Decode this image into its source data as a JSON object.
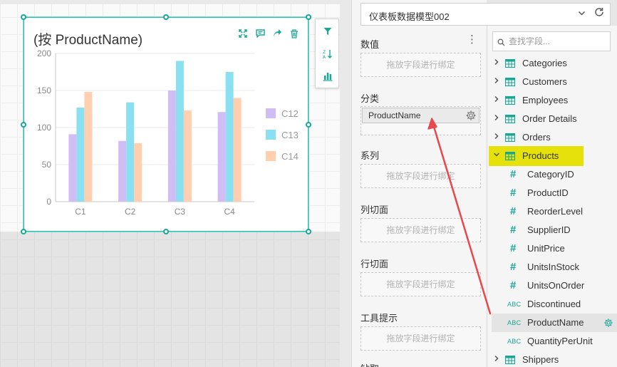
{
  "chart": {
    "title": "(按 ProductName)",
    "toolbar": {
      "expand_icon": "expand-icon",
      "comment_icon": "comment-icon",
      "share_icon": "share-icon",
      "delete_icon": "trash-icon"
    }
  },
  "side_toolbar": [
    "filter-icon",
    "sort-icon",
    "bar-chart-icon"
  ],
  "chart_data": {
    "type": "bar",
    "categories": [
      "C1",
      "C2",
      "C3",
      "C4"
    ],
    "series": [
      {
        "name": "C12",
        "values": [
          91,
          82,
          150,
          121
        ],
        "color": "#d0bdf3"
      },
      {
        "name": "C13",
        "values": [
          127,
          134,
          190,
          175
        ],
        "color": "#8ae0f0"
      },
      {
        "name": "C14",
        "values": [
          148,
          79,
          123,
          140
        ],
        "color": "#ffcfaf"
      }
    ],
    "yticks": [
      0,
      50,
      100,
      150,
      200
    ],
    "ylim": [
      0,
      200
    ],
    "grid": true,
    "legend": "right"
  },
  "binding": {
    "model_name": "仪表板数据模型002",
    "sections": {
      "values": "数值",
      "category": "分类",
      "series": "系列",
      "col_slicer": "列切面",
      "row_slicer": "行切面",
      "tooltip": "工具提示",
      "partial_next": "钻取"
    },
    "drop_placeholder": "拖放字段进行绑定",
    "category_field": "ProductName"
  },
  "fields": {
    "search_placeholder": "查找字段...",
    "tables": [
      {
        "name": "Categories",
        "expanded": false
      },
      {
        "name": "Customers",
        "expanded": false
      },
      {
        "name": "Employees",
        "expanded": false
      },
      {
        "name": "Order Details",
        "expanded": false
      },
      {
        "name": "Orders",
        "expanded": false
      },
      {
        "name": "Products",
        "expanded": true
      },
      {
        "name": "Shippers",
        "expanded": false
      }
    ],
    "products_fields": [
      {
        "name": "CategoryID",
        "type": "#"
      },
      {
        "name": "ProductID",
        "type": "#"
      },
      {
        "name": "ReorderLevel",
        "type": "#"
      },
      {
        "name": "SupplierID",
        "type": "#"
      },
      {
        "name": "UnitPrice",
        "type": "#"
      },
      {
        "name": "UnitsInStock",
        "type": "#"
      },
      {
        "name": "UnitsOnOrder",
        "type": "#"
      },
      {
        "name": "Discontinued",
        "type": "ABC"
      },
      {
        "name": "ProductName",
        "type": "ABC"
      },
      {
        "name": "QuantityPerUnit",
        "type": "ABC"
      }
    ]
  },
  "colors": {
    "accent": "#16a896",
    "highlight": "#e6e10a",
    "arrow": "#e8474c"
  }
}
